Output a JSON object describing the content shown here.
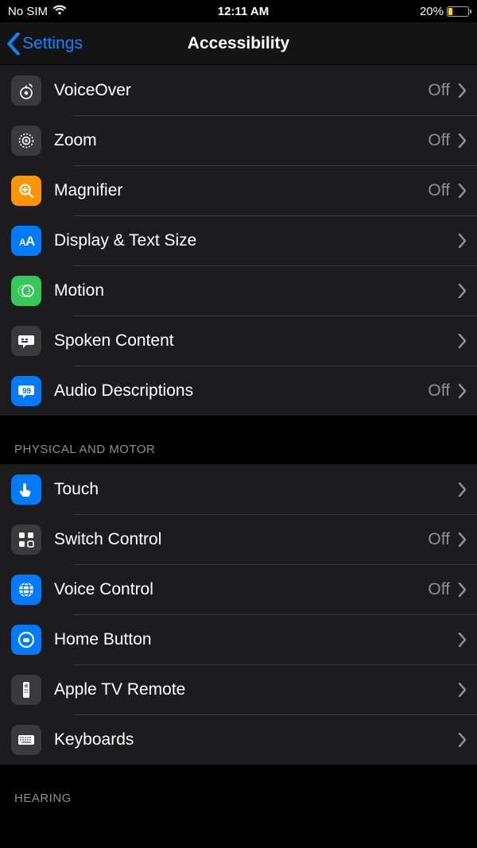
{
  "status": {
    "carrier": "No SIM",
    "time": "12:11 AM",
    "battery_pct": "20%"
  },
  "nav": {
    "back_label": "Settings",
    "title": "Accessibility"
  },
  "off_label": "Off",
  "sections": [
    {
      "header": "",
      "rows": [
        {
          "id": "voiceover",
          "label": "VoiceOver",
          "value": "Off",
          "icon": "voiceover",
          "bg": "bg-gray40"
        },
        {
          "id": "zoom",
          "label": "Zoom",
          "value": "Off",
          "icon": "zoom",
          "bg": "bg-gray40"
        },
        {
          "id": "magnifier",
          "label": "Magnifier",
          "value": "Off",
          "icon": "magnifier",
          "bg": "bg-orange"
        },
        {
          "id": "display-text-size",
          "label": "Display & Text Size",
          "value": "",
          "icon": "textsize",
          "bg": "bg-blue"
        },
        {
          "id": "motion",
          "label": "Motion",
          "value": "",
          "icon": "motion",
          "bg": "bg-green"
        },
        {
          "id": "spoken-content",
          "label": "Spoken Content",
          "value": "",
          "icon": "speechbubble",
          "bg": "bg-gray40"
        },
        {
          "id": "audio-descriptions",
          "label": "Audio Descriptions",
          "value": "Off",
          "icon": "audiodesc",
          "bg": "bg-blue"
        }
      ]
    },
    {
      "header": "PHYSICAL AND MOTOR",
      "rows": [
        {
          "id": "touch",
          "label": "Touch",
          "value": "",
          "icon": "touch",
          "bg": "bg-blue"
        },
        {
          "id": "switch-control",
          "label": "Switch Control",
          "value": "Off",
          "icon": "switch",
          "bg": "bg-gray40"
        },
        {
          "id": "voice-control",
          "label": "Voice Control",
          "value": "Off",
          "icon": "voicectrl",
          "bg": "bg-blue"
        },
        {
          "id": "home-button",
          "label": "Home Button",
          "value": "",
          "icon": "homebtn",
          "bg": "bg-blue"
        },
        {
          "id": "apple-tv-remote",
          "label": "Apple TV Remote",
          "value": "",
          "icon": "tvremote",
          "bg": "bg-gray40"
        },
        {
          "id": "keyboards",
          "label": "Keyboards",
          "value": "",
          "icon": "keyboard",
          "bg": "bg-gray40"
        }
      ]
    },
    {
      "header": "HEARING",
      "rows": []
    }
  ]
}
